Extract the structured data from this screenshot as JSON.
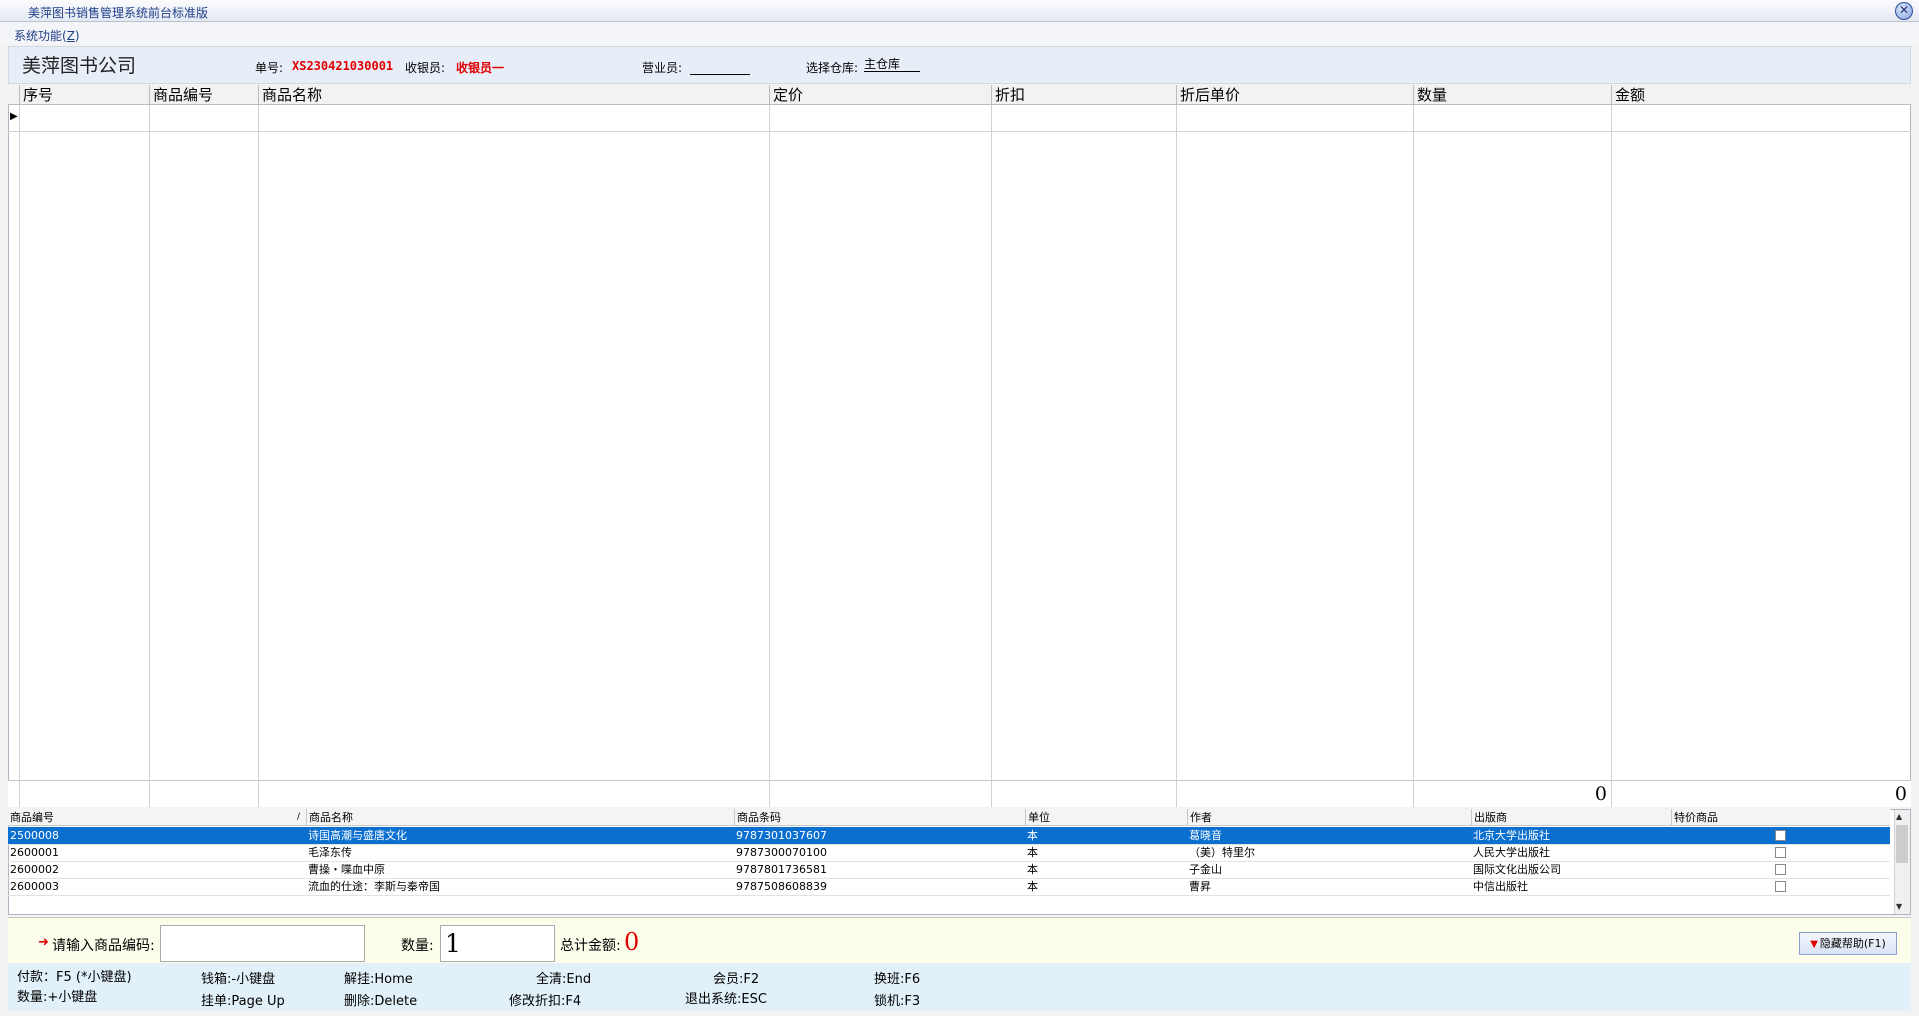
{
  "window": {
    "title": "美萍图书销售管理系统前台标准版"
  },
  "menu": {
    "system_label": "系统功能(",
    "system_key": "Z",
    "system_suffix": ")"
  },
  "header": {
    "company": "美萍图书公司",
    "order_label": "单号:",
    "order_value": "XS230421030001",
    "cashier_label": "收银员:",
    "cashier_value": "收银员一",
    "salesperson_label": "营业员:",
    "warehouse_label": "选择仓库:",
    "warehouse_value": "主仓库"
  },
  "main_table": {
    "columns": [
      "序号",
      "商品编号",
      "商品名称",
      "定价",
      "折扣",
      "折后单价",
      "数量",
      "金额"
    ],
    "footer_quantity": "0",
    "footer_amount": "0"
  },
  "product_list": {
    "columns": [
      "商品编号",
      "商品名称",
      "商品条码",
      "单位",
      "作者",
      "出版商",
      "特价商品"
    ],
    "rows": [
      {
        "code": "2500008",
        "name": "诗国高潮与盛唐文化",
        "barcode": "9787301037607",
        "unit": "本",
        "author": "葛晓音",
        "publisher": "北京大学出版社",
        "special": false
      },
      {
        "code": "2600001",
        "name": "毛泽东传",
        "barcode": "9787300070100",
        "unit": "本",
        "author": "（美）特里尔",
        "publisher": "人民大学出版社",
        "special": false
      },
      {
        "code": "2600002",
        "name": "曹操・喋血中原",
        "barcode": "9787801736581",
        "unit": "本",
        "author": "子金山",
        "publisher": "国际文化出版公司",
        "special": false
      },
      {
        "code": "2600003",
        "name": "流血的仕途：李斯与秦帝国",
        "barcode": "9787508608839",
        "unit": "本",
        "author": "曹昇",
        "publisher": "中信出版社",
        "special": false
      }
    ]
  },
  "input_bar": {
    "code_label": "请输入商品编码:",
    "code_value": "",
    "qty_label": "数量:",
    "qty_value": "1",
    "total_label": "总计金额:",
    "total_value": "0",
    "hide_help_label": "隐藏帮助(F1)"
  },
  "shortcuts": {
    "pay": "付款：F5 (*小键盘)",
    "qty": "数量:+小键盘",
    "cashbox": "钱箱:-小键盘",
    "hold": "挂单:Page Up",
    "unhold": "解挂:Home",
    "delete": "删除:Delete",
    "clear": "全清:End",
    "discount": "修改折扣:F4",
    "member": "会员:F2",
    "exit": "退出系统:ESC",
    "shift": "换班:F6",
    "lock": "锁机:F3"
  },
  "colors": {
    "accent_red": "#e00000",
    "selection_blue": "#0b6fd0",
    "header_bg": "#e7eef8"
  }
}
